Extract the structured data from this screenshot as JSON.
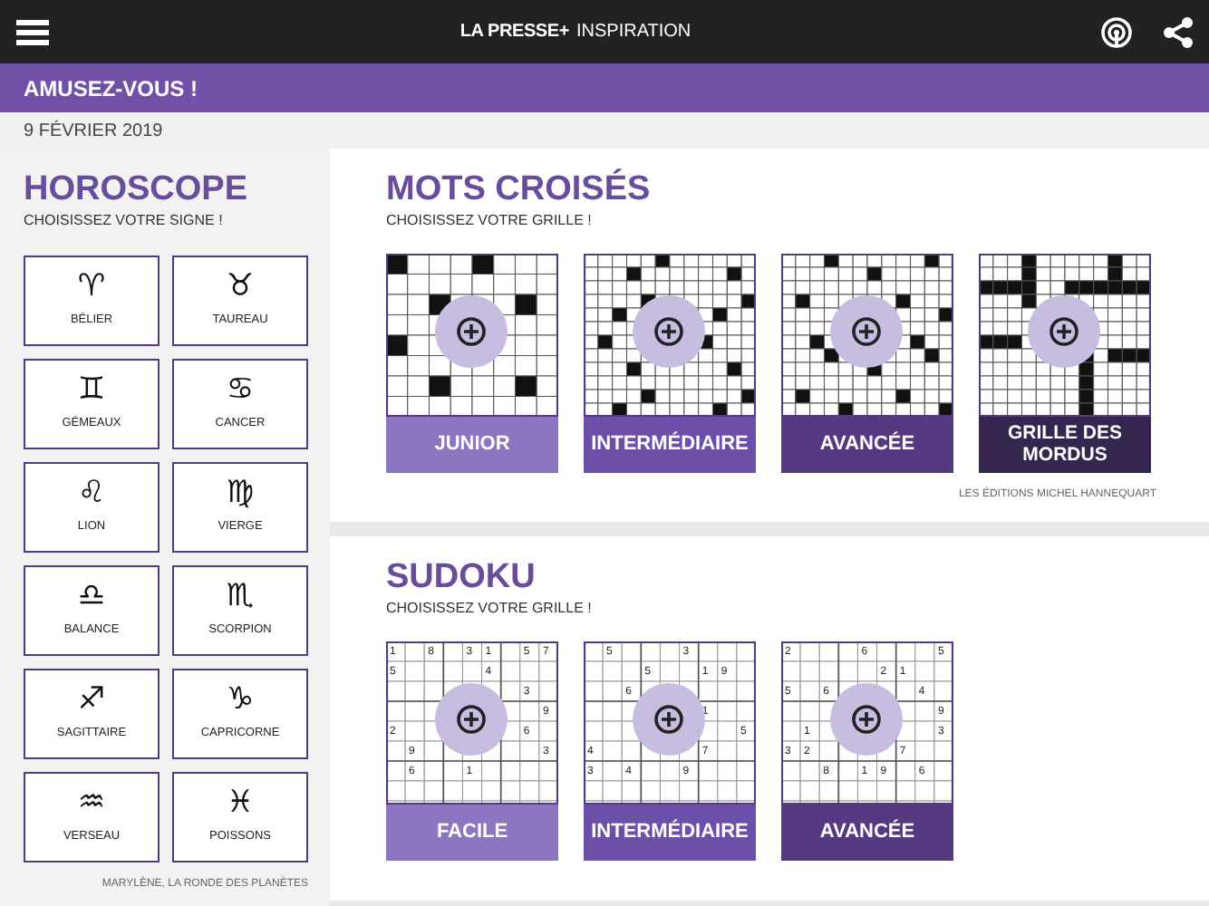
{
  "header": {
    "brand": "LA PRESSE+",
    "section": "INSPIRATION"
  },
  "banner": {
    "title": "AMUSEZ-VOUS !"
  },
  "date": "9 FÉVRIER 2019",
  "horoscope": {
    "title": "HOROSCOPE",
    "subtitle": "CHOISISSEZ VOTRE SIGNE !",
    "signs": [
      {
        "symbol": "♈",
        "name": "BÉLIER"
      },
      {
        "symbol": "♉",
        "name": "TAUREAU"
      },
      {
        "symbol": "♊",
        "name": "GÉMEAUX"
      },
      {
        "symbol": "♋",
        "name": "CANCER"
      },
      {
        "symbol": "♌",
        "name": "LION"
      },
      {
        "symbol": "♍",
        "name": "VIERGE"
      },
      {
        "symbol": "♎",
        "name": "BALANCE"
      },
      {
        "symbol": "♏",
        "name": "SCORPION"
      },
      {
        "symbol": "♐",
        "name": "SAGITTAIRE"
      },
      {
        "symbol": "♑",
        "name": "CAPRICORNE"
      },
      {
        "symbol": "♒",
        "name": "VERSEAU"
      },
      {
        "symbol": "♓",
        "name": "POISSONS"
      }
    ],
    "credit": "MARYLÈNE, LA RONDE DES PLANÈTES"
  },
  "crosswords": {
    "title": "MOTS CROISÉS",
    "subtitle": "CHOISISSEZ VOTRE GRILLE !",
    "grids": [
      {
        "label": "JUNIOR",
        "color": "#8c76bf"
      },
      {
        "label": "INTERMÉDIAIRE",
        "color": "#6c4fa8"
      },
      {
        "label": "AVANCÉE",
        "color": "#553a82"
      },
      {
        "label": "GRILLE DES MORDUS",
        "color": "#35264f"
      }
    ],
    "credit": "LES ÉDITIONS MICHEL HANNEQUART"
  },
  "sudoku": {
    "title": "SUDOKU",
    "subtitle": "CHOISISSEZ VOTRE GRILLE !",
    "grids": [
      {
        "label": "FACILE",
        "color": "#8c76bf",
        "rows": [
          [
            "1",
            null,
            "8",
            null,
            "3",
            "1",
            null,
            "5",
            "7"
          ],
          [
            "5",
            null,
            null,
            null,
            null,
            "4",
            null,
            null,
            null
          ],
          [
            null,
            null,
            null,
            null,
            null,
            null,
            null,
            "3",
            null
          ],
          [
            null,
            null,
            null,
            null,
            null,
            null,
            null,
            null,
            "9"
          ],
          [
            "2",
            null,
            null,
            null,
            null,
            null,
            null,
            "6",
            null
          ],
          [
            null,
            "9",
            null,
            null,
            null,
            null,
            null,
            null,
            "3"
          ],
          [
            null,
            "6",
            null,
            null,
            "1",
            null,
            null,
            null,
            null
          ]
        ]
      },
      {
        "label": "INTERMÉDIAIRE",
        "color": "#6c4fa8",
        "rows": [
          [
            null,
            "5",
            null,
            null,
            null,
            "3",
            null,
            null,
            null
          ],
          [
            null,
            null,
            null,
            "5",
            null,
            null,
            "1",
            "9",
            null
          ],
          [
            null,
            null,
            "6",
            null,
            null,
            null,
            null,
            null,
            null
          ],
          [
            null,
            null,
            null,
            null,
            null,
            null,
            "1",
            null,
            null
          ],
          [
            null,
            null,
            null,
            null,
            null,
            null,
            null,
            null,
            "5"
          ],
          [
            "4",
            null,
            null,
            null,
            null,
            null,
            "7",
            null,
            null
          ],
          [
            "3",
            null,
            "4",
            null,
            null,
            "9",
            null,
            null,
            null
          ]
        ]
      },
      {
        "label": "AVANCÉE",
        "color": "#553a82",
        "rows": [
          [
            "2",
            null,
            null,
            null,
            "6",
            null,
            null,
            null,
            "5"
          ],
          [
            null,
            null,
            null,
            null,
            null,
            "2",
            "1",
            null,
            null
          ],
          [
            "5",
            null,
            "6",
            null,
            null,
            null,
            null,
            "4",
            null
          ],
          [
            null,
            null,
            null,
            null,
            null,
            null,
            null,
            null,
            "9"
          ],
          [
            null,
            "1",
            null,
            null,
            null,
            null,
            null,
            null,
            "3"
          ],
          [
            "3",
            "2",
            null,
            null,
            null,
            null,
            "7",
            null,
            null
          ],
          [
            null,
            null,
            "8",
            null,
            "1",
            "9",
            null,
            "6",
            null
          ]
        ]
      }
    ]
  }
}
